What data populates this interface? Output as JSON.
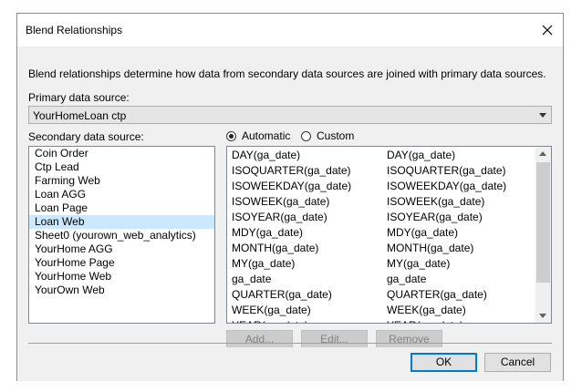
{
  "window": {
    "title": "Blend Relationships"
  },
  "description": "Blend relationships determine how data from secondary data sources are joined with primary data sources.",
  "primary": {
    "label": "Primary data source:",
    "value": "YourHomeLoan ctp"
  },
  "secondary": {
    "label": "Secondary data source:",
    "items": [
      "Coin  Order",
      "Ctp Lead",
      "Farming Web",
      "Loan AGG",
      "Loan Page",
      "Loan Web",
      "Sheet0 (yourown_web_analytics)",
      "YourHome AGG",
      "YourHome Page",
      "YourHome Web",
      "YourOwn Web"
    ],
    "selected_index": 5
  },
  "mode": {
    "automatic_label": "Automatic",
    "custom_label": "Custom",
    "selected": "Automatic"
  },
  "fields": [
    [
      "DAY(ga_date)",
      "DAY(ga_date)"
    ],
    [
      "ISOQUARTER(ga_date)",
      "ISOQUARTER(ga_date)"
    ],
    [
      "ISOWEEKDAY(ga_date)",
      "ISOWEEKDAY(ga_date)"
    ],
    [
      "ISOWEEK(ga_date)",
      "ISOWEEK(ga_date)"
    ],
    [
      "ISOYEAR(ga_date)",
      "ISOYEAR(ga_date)"
    ],
    [
      "MDY(ga_date)",
      "MDY(ga_date)"
    ],
    [
      "MONTH(ga_date)",
      "MONTH(ga_date)"
    ],
    [
      "MY(ga_date)",
      "MY(ga_date)"
    ],
    [
      "ga_date",
      "ga_date"
    ],
    [
      "QUARTER(ga_date)",
      "QUARTER(ga_date)"
    ],
    [
      "WEEK(ga_date)",
      "WEEK(ga_date)"
    ],
    [
      "YEAR(ga_date)",
      "YEAR(ga_date)"
    ]
  ],
  "actions": {
    "add": "Add...",
    "edit": "Edit...",
    "remove": "Remove"
  },
  "footer": {
    "ok": "OK",
    "cancel": "Cancel"
  }
}
